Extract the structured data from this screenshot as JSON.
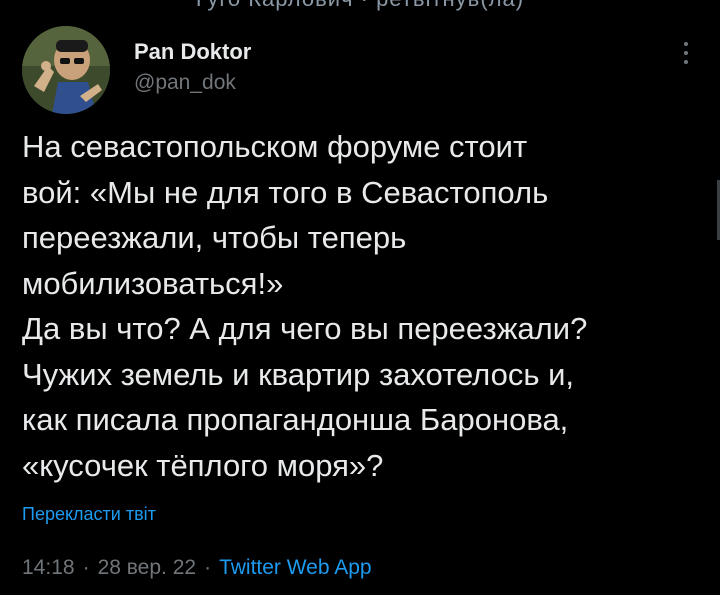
{
  "top_cutoff": "Гуго Карлович · ретвітнув(ла)",
  "author": {
    "display_name": "Pan Doktor",
    "handle": "@pan_dok",
    "avatar_icon": "avatar-image"
  },
  "tweet": {
    "lines": [
      "На севастопольском форуме стоит",
      "вой: «Мы не для того в Севастополь",
      "переезжали, чтобы теперь",
      "мобилизоваться!»",
      "Да вы что? А для чего вы переезжали?",
      "Чужих земель и квартир захотелось и,",
      "как писала пропагандонша Баронова,",
      "«кусочек тёплого моря»?"
    ],
    "translate_label": "Перекласти твіт"
  },
  "meta": {
    "time": "14:18",
    "date": "28 вер. 22",
    "source": "Twitter Web App",
    "separator": "·"
  },
  "colors": {
    "background": "#000000",
    "text": "#e7e9ea",
    "secondary": "#71767b",
    "accent": "#1d9bf0"
  }
}
